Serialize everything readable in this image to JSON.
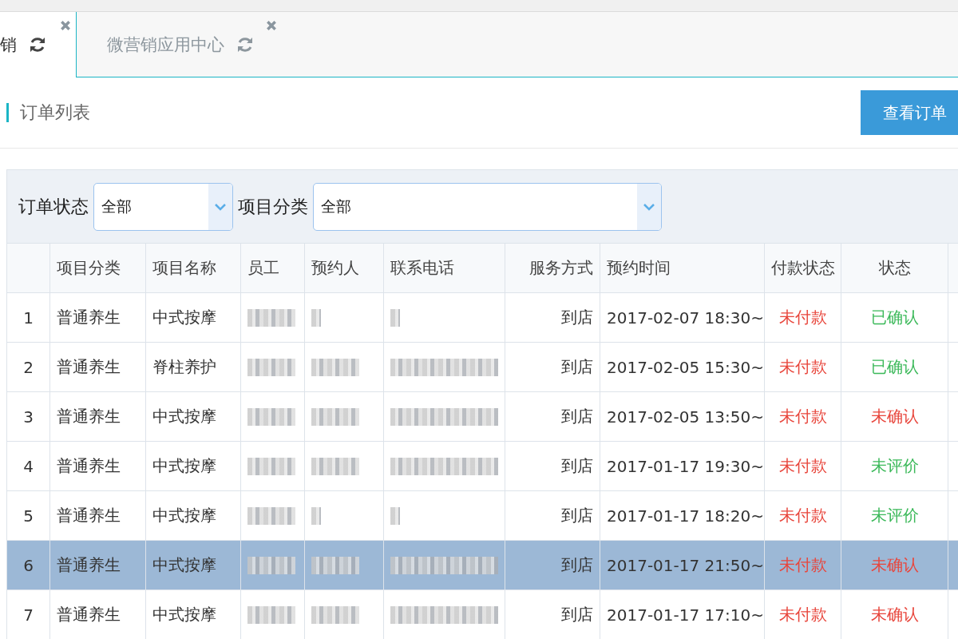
{
  "tabs": [
    {
      "label": "销",
      "selected": true
    },
    {
      "label": "微营销应用中心",
      "selected": false
    }
  ],
  "section": {
    "title": "订单列表",
    "button": "查看订单"
  },
  "filters": [
    {
      "label": "订单状态",
      "value": "全部"
    },
    {
      "label": "项目分类",
      "value": "全部"
    }
  ],
  "table": {
    "columns": [
      "项目分类",
      "项目名称",
      "员工",
      "预约人",
      "联系电话",
      "服务方式",
      "预约时间",
      "付款状态",
      "状态"
    ],
    "rows": [
      {
        "index": "1",
        "category": "普通养生",
        "item": "中式按摩",
        "kind": "short",
        "service": "到店",
        "time": "2017-02-07 18:30~",
        "payment": "未付款",
        "status": "已确认",
        "color": "#3cb95a",
        "selected": false
      },
      {
        "index": "2",
        "category": "普通养生",
        "item": "脊柱养护",
        "kind": "full",
        "service": "到店",
        "time": "2017-02-05 15:30~",
        "payment": "未付款",
        "status": "已确认",
        "color": "#3cb95a",
        "selected": false
      },
      {
        "index": "3",
        "category": "普通养生",
        "item": "中式按摩",
        "kind": "full",
        "service": "到店",
        "time": "2017-02-05 13:50~",
        "payment": "未付款",
        "status": "未确认",
        "color": "#e8463c",
        "selected": false
      },
      {
        "index": "4",
        "category": "普通养生",
        "item": "中式按摩",
        "kind": "full",
        "service": "到店",
        "time": "2017-01-17 19:30~",
        "payment": "未付款",
        "status": "未评价",
        "color": "#3cb95a",
        "selected": false
      },
      {
        "index": "5",
        "category": "普通养生",
        "item": "中式按摩",
        "kind": "short",
        "service": "到店",
        "time": "2017-01-17 18:20~",
        "payment": "未付款",
        "status": "未评价",
        "color": "#3cb95a",
        "selected": false
      },
      {
        "index": "6",
        "category": "普通养生",
        "item": "中式按摩",
        "kind": "full",
        "service": "到店",
        "time": "2017-01-17 21:50~",
        "payment": "未付款",
        "status": "未确认",
        "color": "#e8463c",
        "selected": true
      },
      {
        "index": "7",
        "category": "普通养生",
        "item": "中式按摩",
        "kind": "full",
        "service": "到店",
        "time": "2017-01-17 17:10~",
        "payment": "未付款",
        "status": "未确认",
        "color": "#e8463c",
        "selected": false
      }
    ]
  }
}
